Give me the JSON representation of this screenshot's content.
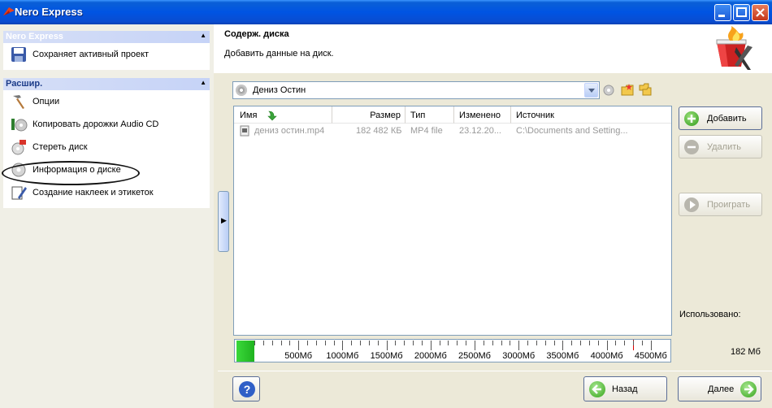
{
  "window": {
    "title": "Nero Express"
  },
  "left": {
    "group1": {
      "header": "Nero Express",
      "items": [
        "Сохраняет активный проект"
      ]
    },
    "group2": {
      "header": "Расшир.",
      "items": [
        "Опции",
        "Копировать дорожки Audio CD",
        "Стереть диск",
        "Информация о диске",
        "Создание наклеек и этикеток"
      ]
    }
  },
  "header": {
    "title": "Содерж. диска",
    "subtitle": "Добавить данные на диск."
  },
  "combo": {
    "value": "Дениз Остин"
  },
  "table": {
    "columns": [
      "Имя",
      "Размер",
      "Тип",
      "Изменено",
      "Источник"
    ],
    "rows": [
      {
        "name": "дениз остин.mp4",
        "size": "182 482 КБ",
        "type": "MP4 file",
        "modified": "23.12.20...",
        "source": "C:\\Documents and Setting..."
      }
    ]
  },
  "buttons": {
    "add": "Добавить",
    "remove": "Удалить",
    "play": "Проиграть",
    "back": "Назад",
    "next": "Далее",
    "help": "?"
  },
  "usage": {
    "label": "Использовано:",
    "value": "182 Мб"
  },
  "ruler": {
    "marks": [
      "500Мб",
      "1000Мб",
      "1500Мб",
      "2000Мб",
      "2500Мб",
      "3000Мб",
      "3500Мб",
      "4000Мб",
      "4500Мб"
    ]
  }
}
